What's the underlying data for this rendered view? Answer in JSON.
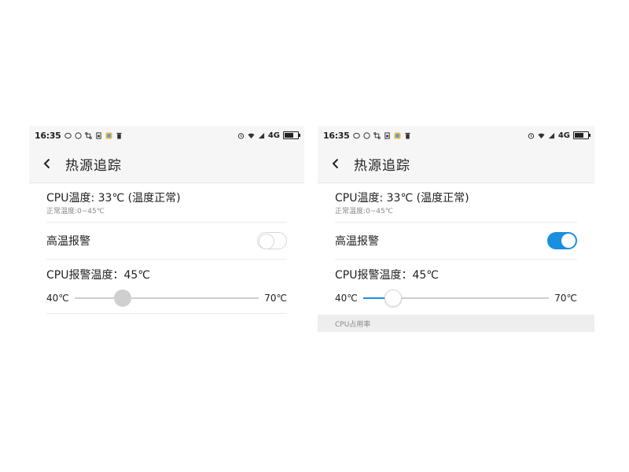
{
  "colors": {
    "accent": "#1a8fe0",
    "toggle_off": "#ffffff",
    "slider_thumb_disabled": "#cfcfcf"
  },
  "phones": [
    {
      "status_bar": {
        "time": "16:35",
        "network": "4G"
      },
      "title": "热源追踪",
      "cpu_temp": "CPU温度: 33℃  (温度正常)",
      "normal_range": "正常温度:0~45℃",
      "alarm": {
        "label": "高温报警",
        "enabled": false
      },
      "slider": {
        "label": "CPU报警温度：45℃",
        "min_label": "40℃",
        "max_label": "70℃",
        "value_fraction": 0.26,
        "enabled": false
      }
    },
    {
      "status_bar": {
        "time": "16:35",
        "network": "4G"
      },
      "title": "热源追踪",
      "cpu_temp": "CPU温度: 33℃  (温度正常)",
      "normal_range": "正常温度:0~45℃",
      "alarm": {
        "label": "高温报警",
        "enabled": true
      },
      "slider": {
        "label": "CPU报警温度：45℃",
        "min_label": "40℃",
        "max_label": "70℃",
        "value_fraction": 0.16,
        "enabled": true
      },
      "section_header": "CPU占用率"
    }
  ]
}
